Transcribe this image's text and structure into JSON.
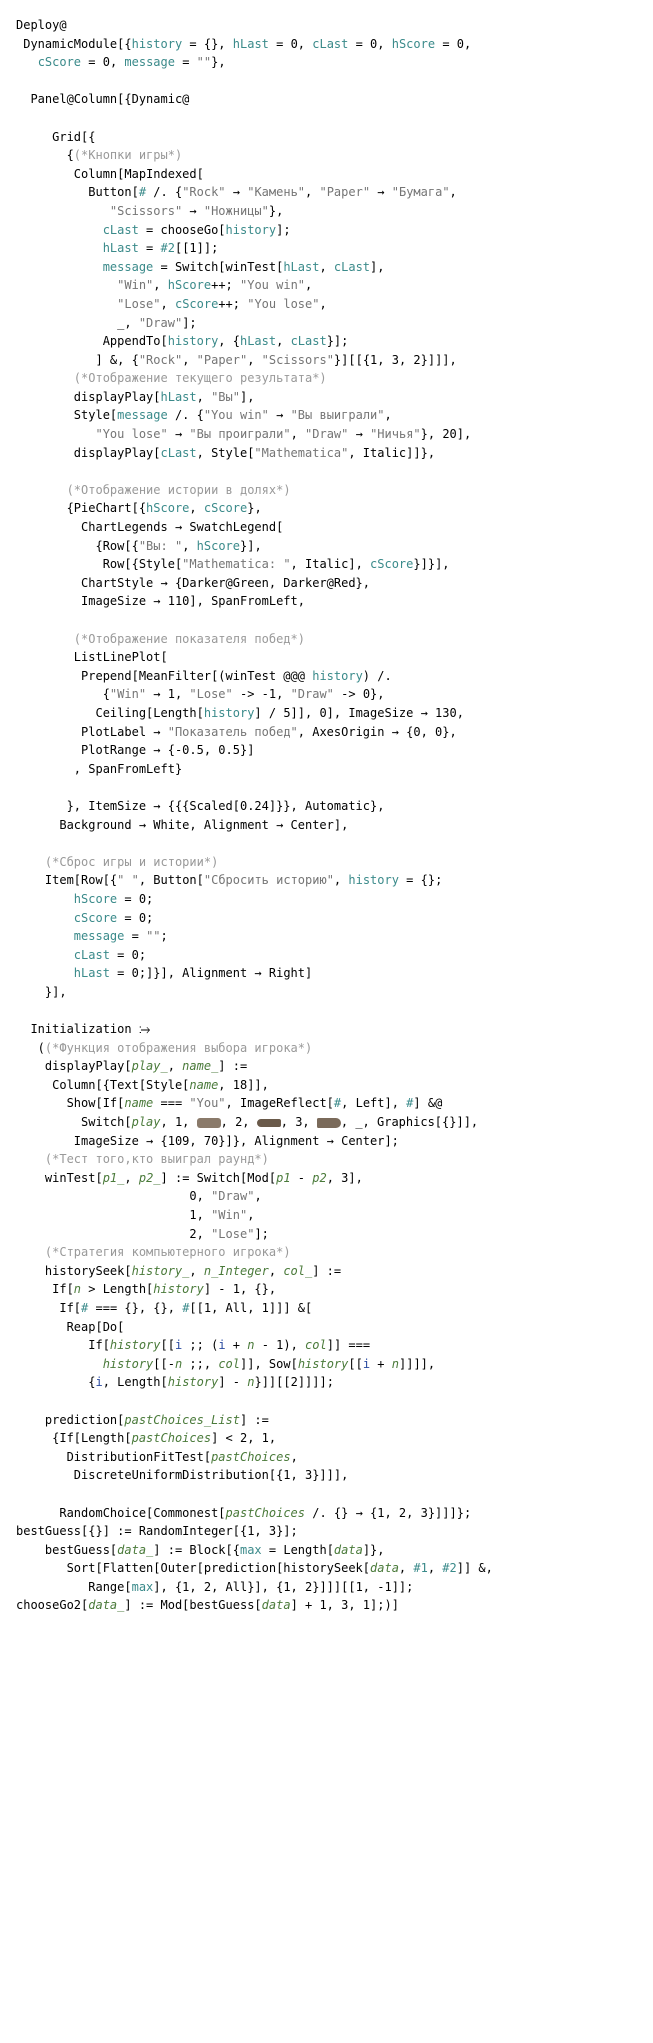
{
  "lines": {
    "l01": "Deploy@",
    "l02a": " DynamicModule",
    "l02b": "[{",
    "l02c": "history",
    "l02d": " = {}, ",
    "l02e": "hLast",
    "l02f": " = 0, ",
    "l02g": "cLast",
    "l02h": " = 0, ",
    "l02i": "hScore",
    "l02j": " = 0,",
    "l03a": "   ",
    "l03b": "cScore",
    "l03c": " = 0, ",
    "l03d": "message",
    "l03e": " = ",
    "l03f": "\"\"",
    "l03g": "},",
    "l05": "  Panel@Column[{Dynamic@",
    "l07": "     Grid[{",
    "l08a": "       {",
    "l08b": "(*Кнопки игры*)",
    "l09": "        Column[MapIndexed[",
    "l10a": "          Button[",
    "l10b": "#",
    "l10c": " /. {",
    "l10d": "\"Rock\"",
    "l10e": " → ",
    "l10f": "\"Камень\"",
    "l10g": ", ",
    "l10h": "\"Paper\"",
    "l10i": " → ",
    "l10j": "\"Бумага\"",
    "l10k": ",",
    "l11a": "             ",
    "l11b": "\"Scissors\"",
    "l11c": " → ",
    "l11d": "\"Ножницы\"",
    "l11e": "},",
    "l12a": "            ",
    "l12b": "cLast",
    "l12c": " = chooseGo[",
    "l12d": "history",
    "l12e": "];",
    "l13a": "            ",
    "l13b": "hLast",
    "l13c": " = ",
    "l13d": "#2",
    "l13e": "[[1]];",
    "l14a": "            ",
    "l14b": "message",
    "l14c": " = Switch[winTest[",
    "l14d": "hLast",
    "l14e": ", ",
    "l14f": "cLast",
    "l14g": "],",
    "l15a": "              ",
    "l15b": "\"Win\"",
    "l15c": ", ",
    "l15d": "hScore",
    "l15e": "++; ",
    "l15f": "\"You win\"",
    "l15g": ",",
    "l16a": "              ",
    "l16b": "\"Lose\"",
    "l16c": ", ",
    "l16d": "cScore",
    "l16e": "++; ",
    "l16f": "\"You lose\"",
    "l16g": ",",
    "l17a": "              _, ",
    "l17b": "\"Draw\"",
    "l17c": "];",
    "l18a": "            AppendTo[",
    "l18b": "history",
    "l18c": ", {",
    "l18d": "hLast",
    "l18e": ", ",
    "l18f": "cLast",
    "l18g": "}];",
    "l19a": "           ] &, {",
    "l19b": "\"Rock\"",
    "l19c": ", ",
    "l19d": "\"Paper\"",
    "l19e": ", ",
    "l19f": "\"Scissors\"",
    "l19g": "}][[{1, 3, 2}]]],",
    "l20a": "        ",
    "l20b": "(*Отображение текущего результата*)",
    "l21a": "        displayPlay[",
    "l21b": "hLast",
    "l21c": ", ",
    "l21d": "\"Вы\"",
    "l21e": "],",
    "l22a": "        Style[",
    "l22b": "message",
    "l22c": " /. {",
    "l22d": "\"You win\"",
    "l22e": " → ",
    "l22f": "\"Вы выиграли\"",
    "l22g": ",",
    "l23a": "           ",
    "l23b": "\"You lose\"",
    "l23c": " → ",
    "l23d": "\"Вы проиграли\"",
    "l23e": ", ",
    "l23f": "\"Draw\"",
    "l23g": " → ",
    "l23h": "\"Ничья\"",
    "l23i": "}, 20],",
    "l24a": "        displayPlay[",
    "l24b": "cLast",
    "l24c": ", Style[",
    "l24d": "\"Mathematica\"",
    "l24e": ", Italic]]},",
    "l26a": "       ",
    "l26b": "(*Отображение истории в долях*)",
    "l27a": "       {PieChart[{",
    "l27b": "hScore",
    "l27c": ", ",
    "l27d": "cScore",
    "l27e": "},",
    "l28": "         ChartLegends → SwatchLegend[",
    "l29a": "           {Row[{",
    "l29b": "\"Вы: \"",
    "l29c": ", ",
    "l29d": "hScore",
    "l29e": "}],",
    "l30a": "            Row[{Style[",
    "l30b": "\"Mathematica: \"",
    "l30c": ", Italic], ",
    "l30d": "cScore",
    "l30e": "}]}],",
    "l31": "         ChartStyle → {Darker@Green, Darker@Red},",
    "l32": "         ImageSize → 110], SpanFromLeft,",
    "l34a": "        ",
    "l34b": "(*Отображение показателя побед*)",
    "l35": "        ListLinePlot[",
    "l36a": "         Prepend[MeanFilter[(winTest @@@ ",
    "l36b": "history",
    "l36c": ") /.",
    "l37a": "            {",
    "l37b": "\"Win\"",
    "l37c": " → 1, ",
    "l37d": "\"Lose\"",
    "l37e": " -> -1, ",
    "l37f": "\"Draw\"",
    "l37g": " -> 0},",
    "l38a": "           Ceiling[Length[",
    "l38b": "history",
    "l38c": "] / 5]], 0], ImageSize → 130,",
    "l39a": "         PlotLabel → ",
    "l39b": "\"Показатель побед\"",
    "l39c": ", AxesOrigin → {0, 0},",
    "l40": "         PlotRange → {-0.5, 0.5}]",
    "l41": "        , SpanFromLeft}",
    "l43": "       }, ItemSize → {{{Scaled[0.24]}}, Automatic},",
    "l44": "      Background → White, Alignment → Center],",
    "l46a": "    ",
    "l46b": "(*Сброс игры и истории*)",
    "l47a": "    Item[Row[{",
    "l47b": "\" \"",
    "l47c": ", Button[",
    "l47d": "\"Сбросить историю\"",
    "l47e": ", ",
    "l47f": "history",
    "l47g": " = {};",
    "l48a": "        ",
    "l48b": "hScore",
    "l48c": " = 0;",
    "l49a": "        ",
    "l49b": "cScore",
    "l49c": " = 0;",
    "l50a": "        ",
    "l50b": "message",
    "l50c": " = ",
    "l50d": "\"\"",
    "l50e": ";",
    "l51a": "        ",
    "l51b": "cLast",
    "l51c": " = 0;",
    "l52a": "        ",
    "l52b": "hLast",
    "l52c": " = 0;]}], Alignment → Right]",
    "l53": "    }],",
    "l55": "  Initialization ⧴",
    "l56a": "   (",
    "l56b": "(*Функция отображения выбора игрока*)",
    "l57a": "    displayPlay[",
    "l57b": "play_",
    "l57c": ", ",
    "l57d": "name_",
    "l57e": "] :=",
    "l58a": "     Column[{Text[Style[",
    "l58b": "name",
    "l58c": ", 18]],",
    "l59a": "       Show[If[",
    "l59b": "name",
    "l59c": " === ",
    "l59d": "\"You\"",
    "l59e": ", ImageReflect[",
    "l59f": "#",
    "l59g": ", Left], ",
    "l59h": "#",
    "l59i": "] &@",
    "l60a": "         Switch[",
    "l60b": "play",
    "l60c": ", 1, ",
    "l60d": ", 2, ",
    "l60e": ", 3, ",
    "l60f": ", _, Graphics[{}]],",
    "l61": "        ImageSize → {109, 70}]}, Alignment → Center];",
    "l62a": "    ",
    "l62b": "(*Тест того,кто выиграл раунд*)",
    "l63a": "    winTest[",
    "l63b": "p1_",
    "l63c": ", ",
    "l63d": "p2_",
    "l63e": "] := Switch[Mod[",
    "l63f": "p1",
    "l63g": " - ",
    "l63h": "p2",
    "l63i": ", 3],",
    "l64a": "                        0, ",
    "l64b": "\"Draw\"",
    "l64c": ",",
    "l65a": "                        1, ",
    "l65b": "\"Win\"",
    "l65c": ",",
    "l66a": "                        2, ",
    "l66b": "\"Lose\"",
    "l66c": "];",
    "l67a": "    ",
    "l67b": "(*Стратегия компьютерного игрока*)",
    "l68a": "    historySeek[",
    "l68b": "history_",
    "l68c": ", ",
    "l68d": "n_Integer",
    "l68e": ", ",
    "l68f": "col_",
    "l68g": "] :=",
    "l69a": "     If[",
    "l69b": "n",
    "l69c": " > Length[",
    "l69d": "history",
    "l69e": "] - 1, {},",
    "l70a": "      If[",
    "l70b": "#",
    "l70c": " === {}, {}, ",
    "l70d": "#",
    "l70e": "[[1, All, 1]]] &[",
    "l71": "       Reap[Do[",
    "l72a": "          If[",
    "l72b": "history",
    "l72c": "[[",
    "l72d": "i",
    "l72e": " ;; (",
    "l72f": "i",
    "l72g": " + ",
    "l72h": "n",
    "l72i": " - 1), ",
    "l72j": "col",
    "l72k": "]] ===",
    "l73a": "            ",
    "l73b": "history",
    "l73c": "[[-",
    "l73d": "n",
    "l73e": " ;;, ",
    "l73f": "col",
    "l73g": "]], Sow[",
    "l73h": "history",
    "l73i": "[[",
    "l73j": "i",
    "l73k": " + ",
    "l73l": "n",
    "l73m": "]]]],",
    "l74a": "          {",
    "l74b": "i",
    "l74c": ", Length[",
    "l74d": "history",
    "l74e": "] - ",
    "l74f": "n",
    "l74g": "}]][[2]]]];",
    "l76a": "    prediction[",
    "l76b": "pastChoices_List",
    "l76c": "] :=",
    "l77a": "     {If[Length[",
    "l77b": "pastChoices",
    "l77c": "] < 2, 1,",
    "l78a": "       DistributionFitTest[",
    "l78b": "pastChoices",
    "l78c": ",",
    "l79": "        DiscreteUniformDistribution[{1, 3}]]],",
    "l81a": "      RandomChoice[Commonest[",
    "l81b": "pastChoices",
    "l81c": " /. {} → {1, 2, 3}]]]};",
    "l82": "bestGuess[{}] := RandomInteger[{1, 3}];",
    "l83a": "    bestGuess[",
    "l83b": "data_",
    "l83c": "] := Block[{",
    "l83d": "max",
    "l83e": " = Length[",
    "l83f": "data",
    "l83g": "]},",
    "l84a": "       Sort[Flatten[Outer[prediction[historySeek[",
    "l84b": "data",
    "l84c": ", ",
    "l84d": "#1",
    "l84e": ", ",
    "l84f": "#2",
    "l84g": "]] &,",
    "l85a": "          Range[",
    "l85b": "max",
    "l85c": "], {1, 2, All}], {1, 2}]]][[1, -1]];",
    "l86a": "chooseGo2[",
    "l86b": "data_",
    "l86c": "] := Mod[bestGuess[",
    "l86d": "data",
    "l86e": "] + 1, 3, 1];)]"
  }
}
